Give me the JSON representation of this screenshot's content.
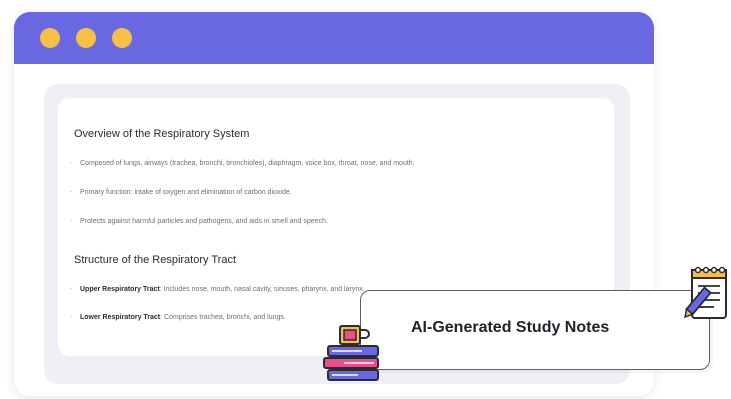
{
  "window": {
    "titlebar_color": "#6A67E2",
    "dot_color": "#F5C044",
    "dots": [
      "dot-1",
      "dot-2",
      "dot-3"
    ]
  },
  "notes": {
    "section1": {
      "title": "Overview of the Respiratory System",
      "bullets": [
        "Composed of lungs, airways (trachea, bronchi, bronchioles), diaphragm, voice box, throat, nose, and mouth.",
        "Primary function: intake of oxygen and elimination of carbon dioxide.",
        "Protects against harmful particles and pathogens, and aids in smell and speech."
      ]
    },
    "section2": {
      "title": "Structure of the Respiratory Tract",
      "bullets": [
        {
          "bold": "Upper Respiratory Tract",
          "text": ": Includes nose, mouth, nasal cavity, sinuses, pharynx, and larynx."
        },
        {
          "bold": "Lower Respiratory Tract",
          "text": ": Comprises trachea, bronchi, and lungs."
        }
      ]
    }
  },
  "badge": {
    "label": "AI-Generated Study Notes"
  },
  "icons": {
    "left": "books-and-mug-icon",
    "right": "notepad-and-pencil-icon"
  }
}
